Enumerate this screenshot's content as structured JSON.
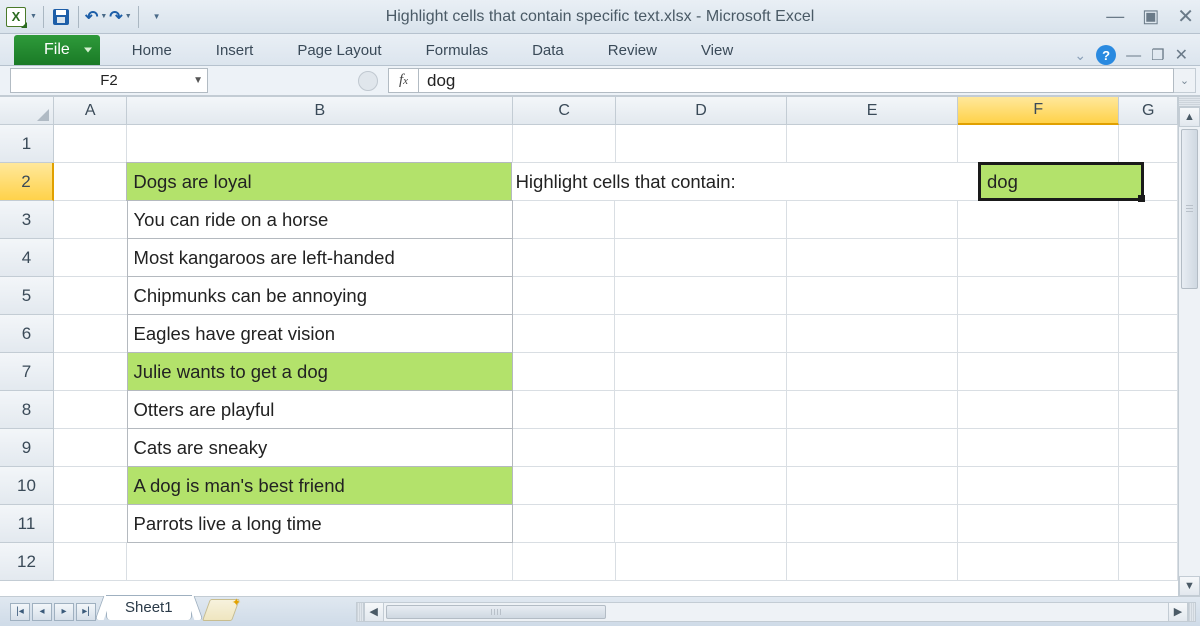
{
  "title": "Highlight cells that contain specific text.xlsx  -  Microsoft Excel",
  "ribbon_tabs": [
    "File",
    "Home",
    "Insert",
    "Page Layout",
    "Formulas",
    "Data",
    "Review",
    "View"
  ],
  "namebox": "F2",
  "formula": "dog",
  "columns": [
    "A",
    "B",
    "C",
    "D",
    "E",
    "F",
    "G"
  ],
  "active_column_index": 5,
  "rows_shown": 12,
  "active_row": 2,
  "label_text": "Highlight cells that contain:",
  "search_value": "dog",
  "data_b": [
    {
      "row": 2,
      "text": "Dogs are loyal",
      "highlight": true
    },
    {
      "row": 3,
      "text": "You can ride on a horse",
      "highlight": false
    },
    {
      "row": 4,
      "text": "Most kangaroos are left-handed",
      "highlight": false
    },
    {
      "row": 5,
      "text": "Chipmunks can be annoying",
      "highlight": false
    },
    {
      "row": 6,
      "text": "Eagles have great vision",
      "highlight": false
    },
    {
      "row": 7,
      "text": "Julie wants to get a dog",
      "highlight": true
    },
    {
      "row": 8,
      "text": "Otters are playful",
      "highlight": false
    },
    {
      "row": 9,
      "text": "Cats are sneaky",
      "highlight": false
    },
    {
      "row": 10,
      "text": "A dog is man's best friend",
      "highlight": true
    },
    {
      "row": 11,
      "text": "Parrots live a long time",
      "highlight": false
    }
  ],
  "sheet_name": "Sheet1",
  "chart_data": {
    "type": "table",
    "title": "Highlight cells that contain specific text",
    "search_term": "dog",
    "rows": [
      {
        "text": "Dogs are loyal",
        "match": true
      },
      {
        "text": "You can ride on a horse",
        "match": false
      },
      {
        "text": "Most kangaroos are left-handed",
        "match": false
      },
      {
        "text": "Chipmunks can be annoying",
        "match": false
      },
      {
        "text": "Eagles have great vision",
        "match": false
      },
      {
        "text": "Julie wants to get a dog",
        "match": true
      },
      {
        "text": "Otters are playful",
        "match": false
      },
      {
        "text": "Cats are sneaky",
        "match": false
      },
      {
        "text": "A dog is man's best friend",
        "match": true
      },
      {
        "text": "Parrots live a long time",
        "match": false
      }
    ]
  }
}
